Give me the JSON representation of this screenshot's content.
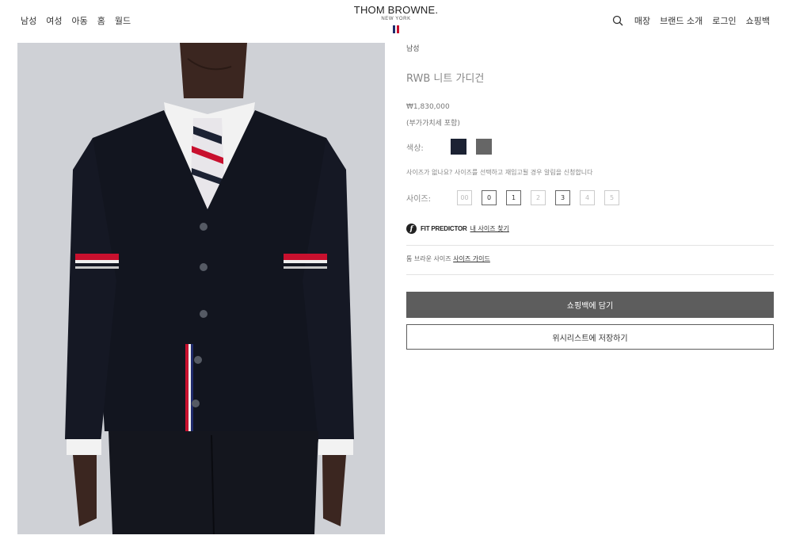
{
  "header": {
    "nav_left": [
      "남성",
      "여성",
      "아동",
      "홈",
      "월드"
    ],
    "logo": {
      "brand": "THOM BROWNE.",
      "sub": "NEW YORK"
    },
    "nav_right": [
      "매장",
      "브랜드 소개",
      "로그인",
      "쇼핑백"
    ],
    "search_icon": "search-icon"
  },
  "product": {
    "category": "남성",
    "title": "RWB 니트 가디건",
    "price": "₩1,830,000",
    "vat": "(부가가치세 포함)",
    "color_label": "색상:",
    "colors": [
      {
        "name": "navy",
        "hex": "#1c2233"
      },
      {
        "name": "grey",
        "hex": "#666666"
      }
    ],
    "size_hint": "사이즈가 없나요? 사이즈를 선택하고 재입고될 경우 알림을 신청합니다",
    "size_label": "사이즈:",
    "sizes": [
      {
        "label": "00",
        "available": false
      },
      {
        "label": "0",
        "available": true
      },
      {
        "label": "1",
        "available": true
      },
      {
        "label": "2",
        "available": false
      },
      {
        "label": "3",
        "available": true
      },
      {
        "label": "4",
        "available": false
      },
      {
        "label": "5",
        "available": false
      }
    ],
    "fit_predictor": {
      "brand": "FIT PREDICTOR",
      "link": "내 사이즈 찾기",
      "icon": "fit-predictor-icon"
    },
    "size_guide": {
      "prefix": "톰 브라운 사이즈",
      "link": "사이즈 가이드"
    },
    "add_to_bag": "쇼핑백에 담기",
    "add_to_wishlist": "위시리스트에 저장하기"
  },
  "colors": {
    "button_bg": "#5d5d5d",
    "flag_blue": "#1f2a6b",
    "flag_white": "#ffffff",
    "flag_red": "#c8102e"
  }
}
